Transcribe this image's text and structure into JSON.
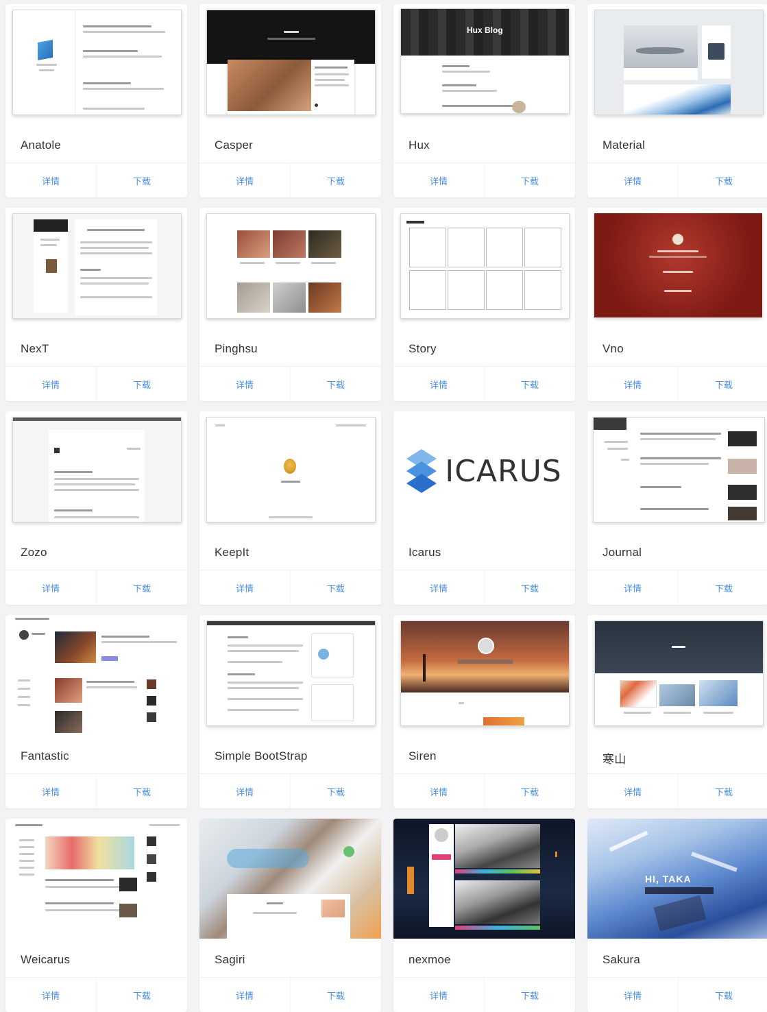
{
  "colors": {
    "link": "#4a90e2",
    "card": "#ffffff",
    "background": "#f3f3f5"
  },
  "themes": [
    {
      "name": "Anatole",
      "details": "详情",
      "download": "下载"
    },
    {
      "name": "Casper",
      "details": "详情",
      "download": "下载"
    },
    {
      "name": "Hux",
      "details": "详情",
      "download": "下载"
    },
    {
      "name": "Material",
      "details": "详情",
      "download": "下载"
    },
    {
      "name": "NexT",
      "details": "详情",
      "download": "下载"
    },
    {
      "name": "Pinghsu",
      "details": "详情",
      "download": "下载"
    },
    {
      "name": "Story",
      "details": "详情",
      "download": "下载"
    },
    {
      "name": "Vno",
      "details": "详情",
      "download": "下载"
    },
    {
      "name": "Zozo",
      "details": "详情",
      "download": "下载"
    },
    {
      "name": "KeepIt",
      "details": "详情",
      "download": "下载"
    },
    {
      "name": "Icarus",
      "details": "详情",
      "download": "下载"
    },
    {
      "name": "Journal",
      "details": "详情",
      "download": "下载"
    },
    {
      "name": "Fantastic",
      "details": "详情",
      "download": "下载"
    },
    {
      "name": "Simple BootStrap",
      "details": "详情",
      "download": "下载"
    },
    {
      "name": "Siren",
      "details": "详情",
      "download": "下载"
    },
    {
      "name": "寒山",
      "details": "详情",
      "download": "下载"
    },
    {
      "name": "Weicarus",
      "details": "详情",
      "download": "下载"
    },
    {
      "name": "Sagiri",
      "details": "详情",
      "download": "下载"
    },
    {
      "name": "nexmoe",
      "details": "详情",
      "download": "下载"
    },
    {
      "name": "Sakura",
      "details": "详情",
      "download": "下载"
    }
  ],
  "thumb_text": {
    "hux_title": "Hux Blog",
    "icarus_logo": "ICARUS",
    "sakura_greeting": "HI, TAKA"
  }
}
